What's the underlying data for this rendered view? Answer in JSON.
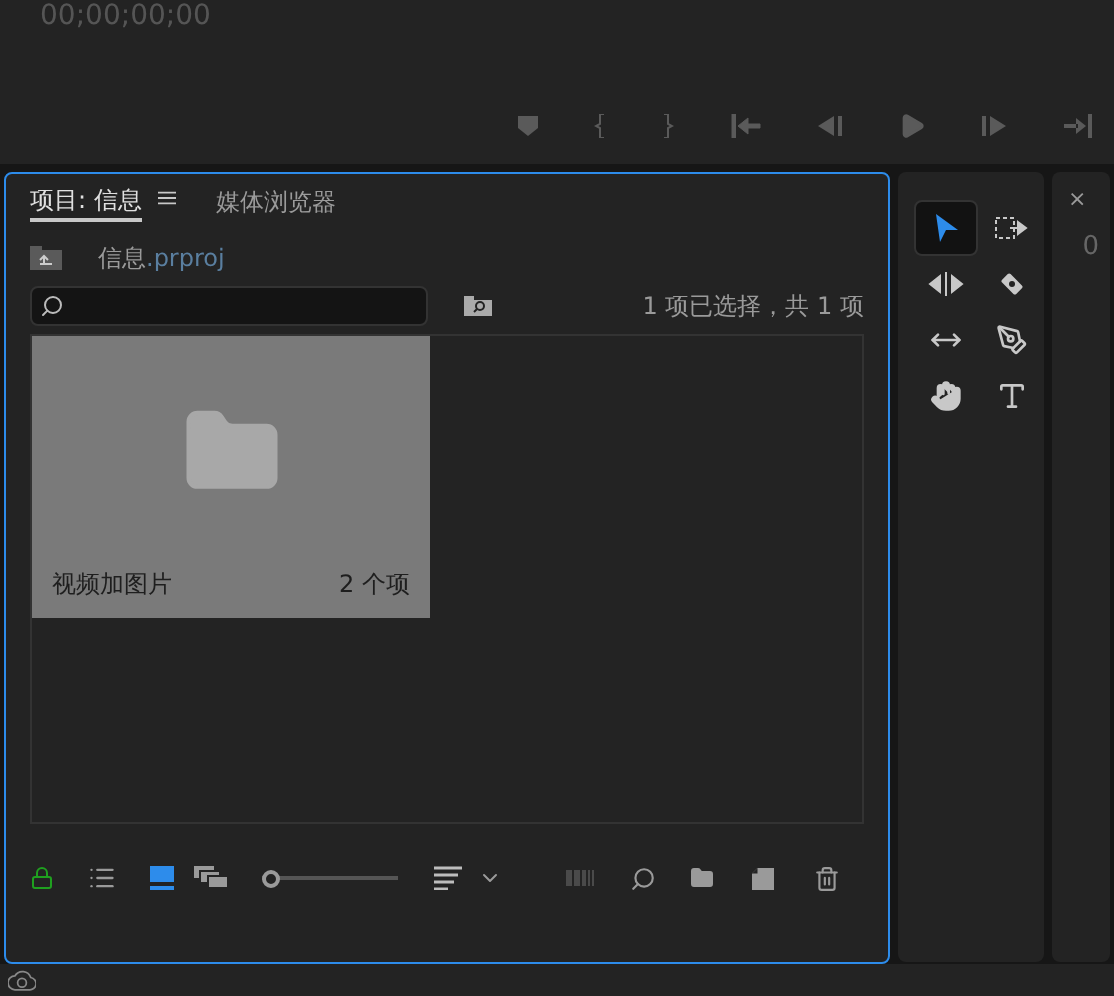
{
  "monitor": {
    "timecode": "00;00;00;00"
  },
  "project_panel": {
    "tabs": [
      {
        "label": "项目: 信息",
        "selected": true
      },
      {
        "label": "媒体浏览器",
        "selected": false
      }
    ],
    "project_file": {
      "name": "信息",
      "extension": ".prproj"
    },
    "selection_status": "1 项已选择，共 1 项",
    "bins": [
      {
        "name": "视频加图片",
        "count": "2 个项",
        "selected": true
      }
    ],
    "zoom_slider": {
      "level": 0.0
    }
  },
  "tools": [
    {
      "kind": "select",
      "selected": true
    },
    {
      "kind": "track",
      "selected": false
    },
    {
      "kind": "ripple",
      "selected": false
    },
    {
      "kind": "razor",
      "selected": false
    },
    {
      "kind": "slip",
      "selected": false
    },
    {
      "kind": "pen",
      "selected": false
    },
    {
      "kind": "hand",
      "selected": false
    },
    {
      "kind": "type",
      "selected": false
    }
  ],
  "right_panel": {
    "close": "×",
    "timecode": "0"
  }
}
